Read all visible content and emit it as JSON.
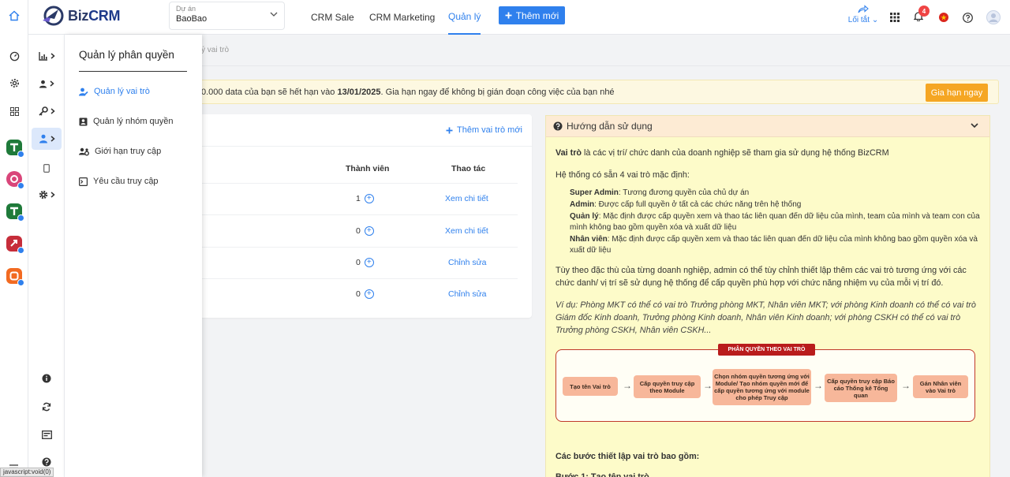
{
  "header": {
    "logo_text": "Biz",
    "logo_text_accent": "CRM",
    "project_label": "Dự án",
    "project_value": "BaoBao",
    "nav": [
      "CRM Sale",
      "CRM Marketing",
      "Quản lý"
    ],
    "active_nav": "Quản lý",
    "new_button": "Thêm mới",
    "shortcut_label": "Lối tắt",
    "notification_count": "4"
  },
  "breadcrumb": "ý vai trò",
  "menu": {
    "title": "Quản lý phân quyền",
    "items": [
      {
        "label": "Quản lý vai trò",
        "icon": "user-edit-icon",
        "active": true
      },
      {
        "label": "Quản lý nhóm quyền",
        "icon": "id-card-icon",
        "active": false
      },
      {
        "label": "Giới hạn truy cập",
        "icon": "users-cog-icon",
        "active": false
      },
      {
        "label": "Yêu cầu truy cập",
        "icon": "terminal-icon",
        "active": false
      }
    ]
  },
  "notice": {
    "prefix": "0.000 data của bạn sẽ hết hạn vào ",
    "date": "13/01/2025",
    "suffix": ". Gia hạn ngay để không bị gián đoạn công việc của bạn nhé",
    "renew_button": "Gia hạn ngay"
  },
  "roles": {
    "add_label": "Thêm vai trò mới",
    "columns": [
      "Thành viên",
      "Thao tác"
    ],
    "rows": [
      {
        "members": "1",
        "action": "Xem chi tiết"
      },
      {
        "members": "0",
        "action": "Xem chi tiết"
      },
      {
        "members": "0",
        "action": "Chỉnh sửa"
      },
      {
        "members": "0",
        "action": "Chỉnh sửa"
      }
    ]
  },
  "guide": {
    "title": "Hướng dẫn sử dụng",
    "intro_bold": "Vai trò",
    "intro_rest": " là các vị trí/ chức danh của doanh nghiệp sẽ tham gia sử dụng hệ thống BizCRM",
    "default_roles": "Hệ thống có sẵn 4 vai trò mặc định:",
    "roles_list": [
      {
        "name": "Super Admin",
        "desc": ": Tương đương quyền của chủ dự án"
      },
      {
        "name": "Admin",
        "desc": ": Được cấp full quyền ở tất cả các chức năng trên hệ thống"
      },
      {
        "name": "Quản lý",
        "desc": ": Mặc định được cấp quyền xem và thao tác liên quan đến dữ liệu của mình, team của mình và team con của mình không bao gồm quyền xóa và xuất dữ liệu"
      },
      {
        "name": "Nhân viên",
        "desc": ": Mặc định được cấp quyền xem và thao tác liên quan đến dữ liệu của mình không bao gồm quyền xóa và xuất dữ liệu"
      }
    ],
    "custom_note": "Tùy theo đặc thù của từng doanh nghiệp, admin có thể tùy chỉnh thiết lập thêm các vai trò tương ứng với các chức danh/ vị trí sẽ sử dụng hệ thống để cấp quyền phù hợp với chức năng nhiệm vụ của mỗi vị trí đó.",
    "example": "Ví dụ: Phòng MKT có thể có vai trò Trưởng phòng MKT, Nhân viên MKT; với phòng Kinh doanh có thể có vai trò Giám đốc Kinh doanh, Trưởng phòng Kinh doanh, Nhân viên Kinh doanh; với phòng CSKH có thể có vai trò Trưởng phòng CSKH, Nhân viên CSKH...",
    "flow_title": "PHÂN QUYỀN THEO VAI TRÒ",
    "flow_steps": [
      "Tạo tên Vai trò",
      "Cấp quyền truy cập theo Module",
      "Chọn nhóm quyền tương ứng với Module/ Tạo nhóm quyền mới để cấp quyền tương ứng với module cho phép Truy cập",
      "Cấp quyền truy cập Báo cáo Thống kê Tổng quan",
      "Gán Nhân viên vào Vai trò"
    ],
    "steps_heading": "Các bước thiết lập vai trò bao gồm:",
    "step1": "Bước 1: Tạo tên vai trò"
  },
  "statusbar": "javascript:void(0)",
  "colors": {
    "accent": "#2f80ed",
    "warning": "#f5a623",
    "guide_bg": "#fdfbc9",
    "badge": "#ef4444"
  }
}
